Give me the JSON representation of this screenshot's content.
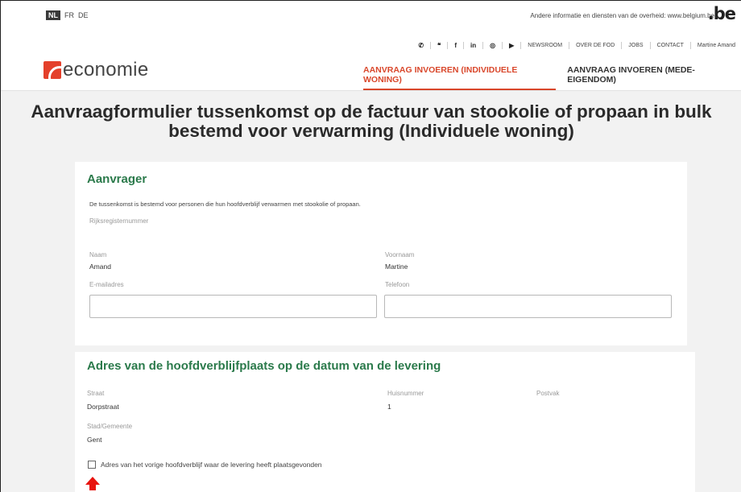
{
  "header": {
    "languages": [
      "NL",
      "FR",
      "DE"
    ],
    "belgium_text": "Andere informatie en diensten van de overheid: www.belgium.be",
    "be_logo": ".be",
    "social_icons": [
      "phone-icon",
      "twitter-icon",
      "facebook-icon",
      "linkedin-icon",
      "instagram-icon",
      "youtube-icon"
    ],
    "social_glyphs": [
      "✆",
      "🐦",
      "f",
      "in",
      "◎",
      "▶"
    ],
    "topnav": [
      "NEWSROOM",
      "OVER DE FOD",
      "JOBS",
      "CONTACT",
      "Martine Amand"
    ],
    "logo_text": "economie",
    "mainnav": [
      "AANVRAAG INVOEREN (INDIVIDUELE WONING)",
      "AANVRAAG INVOEREN (MEDE-EIGENDOM)"
    ]
  },
  "page": {
    "title_line1": "Aanvraagformulier tussenkomst op de factuur van stookolie of propaan in bulk",
    "title_line2": "bestemd voor verwarming (Individuele woning)"
  },
  "applicant": {
    "title": "Aanvrager",
    "note": "De tussenkomst is bestemd voor personen die hun hoofdverblijf verwarmen met stookolie of propaan.",
    "rrn_label": "Rijksregisternummer",
    "name_label": "Naam",
    "name_value": "Amand",
    "firstname_label": "Voornaam",
    "firstname_value": "Martine",
    "email_label": "E-mailadres",
    "email_value": "",
    "phone_label": "Telefoon",
    "phone_value": ""
  },
  "address": {
    "title": "Adres van de hoofdverblijfplaats op de datum van de levering",
    "street_label": "Straat",
    "street_value": "Dorpstraat",
    "number_label": "Huisnummer",
    "number_value": "1",
    "box_label": "Postvak",
    "city_label": "Stad/Gemeente",
    "city_value": "Gent",
    "checkbox_label": "Adres van het vorige hoofdverblijf waar de levering heeft plaatsgevonden"
  },
  "colors": {
    "accent": "#d9472b",
    "section_title": "#2b7a4b",
    "arrow": "#e8140f"
  }
}
